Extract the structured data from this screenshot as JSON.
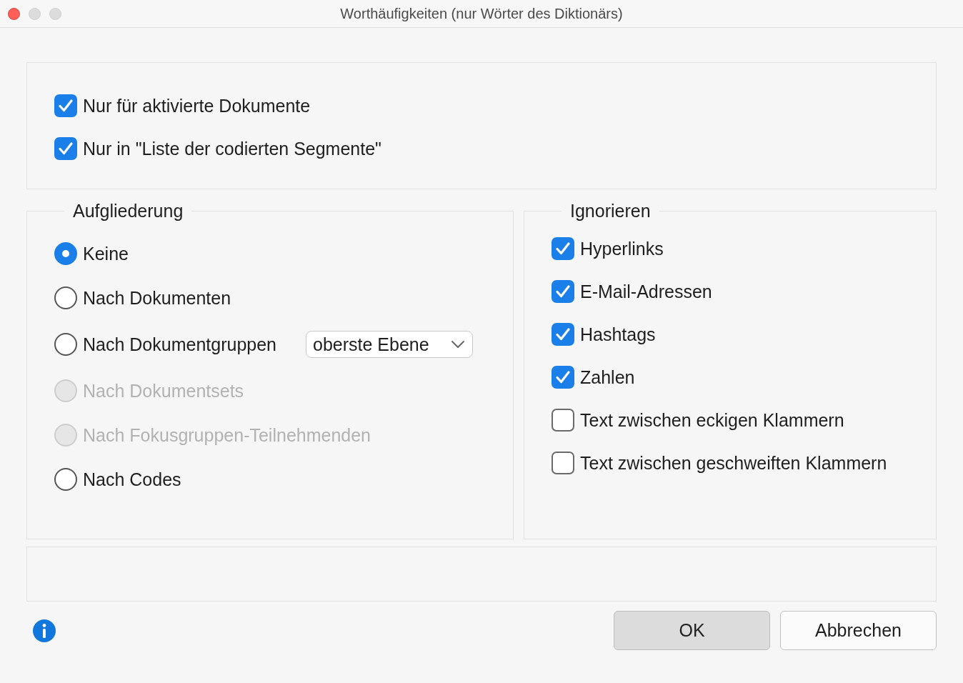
{
  "window": {
    "title": "Worthäufigkeiten (nur Wörter des Diktionärs)"
  },
  "top_options": [
    {
      "label": "Nur für aktivierte Dokumente",
      "checked": true
    },
    {
      "label": "Nur in \"Liste der codierten Segmente\"",
      "checked": true
    }
  ],
  "breakdown": {
    "title": "Aufgliederung",
    "options": [
      {
        "label": "Keine",
        "selected": true,
        "disabled": false
      },
      {
        "label": "Nach Dokumenten",
        "selected": false,
        "disabled": false
      },
      {
        "label": "Nach Dokumentgruppen",
        "selected": false,
        "disabled": false,
        "dropdown": {
          "value": "oberste Ebene"
        }
      },
      {
        "label": "Nach Dokumentsets",
        "selected": false,
        "disabled": true
      },
      {
        "label": "Nach Fokusgruppen-Teilnehmenden",
        "selected": false,
        "disabled": true
      },
      {
        "label": "Nach Codes",
        "selected": false,
        "disabled": false
      }
    ]
  },
  "ignore": {
    "title": "Ignorieren",
    "options": [
      {
        "label": "Hyperlinks",
        "checked": true
      },
      {
        "label": "E-Mail-Adressen",
        "checked": true
      },
      {
        "label": "Hashtags",
        "checked": true
      },
      {
        "label": "Zahlen",
        "checked": true
      },
      {
        "label": "Text zwischen eckigen Klammern",
        "checked": false
      },
      {
        "label": "Text zwischen geschweiften Klammern",
        "checked": false
      }
    ]
  },
  "buttons": [
    {
      "label": "OK",
      "kind": "default"
    },
    {
      "label": "Abbrechen",
      "kind": "normal"
    }
  ]
}
